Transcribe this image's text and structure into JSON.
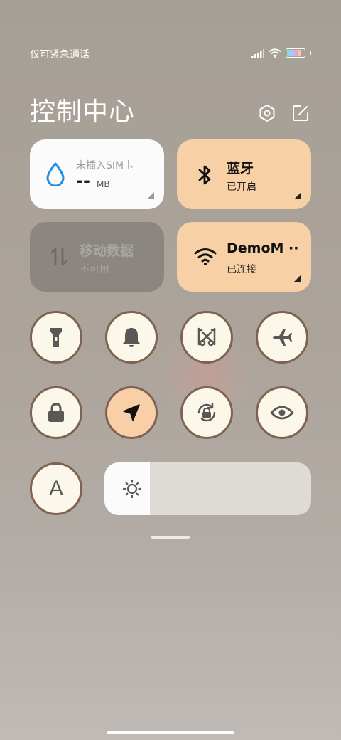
{
  "status_bar": {
    "carrier": "仅可紧急通话",
    "icons": [
      "signal-icon",
      "wifi-icon",
      "battery-icon"
    ],
    "battery_level": 0.9
  },
  "header": {
    "title": "控制中心",
    "icons": [
      "settings-icon",
      "edit-icon"
    ]
  },
  "tiles": {
    "sim": {
      "title": "未插入SIM卡",
      "value": "--",
      "unit": "MB",
      "icon": "water-drop-icon"
    },
    "bluetooth": {
      "title": "蓝牙",
      "status": "已开启",
      "icon": "bluetooth-icon",
      "active": true
    },
    "mobile_data": {
      "title": "移动数据",
      "status": "不可用",
      "icon": "data-arrows-icon",
      "active": false
    },
    "wifi": {
      "title": "DemoM ··",
      "status": "已连接",
      "icon": "wifi-icon",
      "active": true
    }
  },
  "toggles": [
    {
      "name": "flashlight",
      "icon": "flashlight-icon",
      "active": false
    },
    {
      "name": "silent",
      "icon": "bell-icon",
      "active": false
    },
    {
      "name": "screenshot",
      "icon": "scissors-icon",
      "active": false
    },
    {
      "name": "airplane",
      "icon": "airplane-icon",
      "active": false
    },
    {
      "name": "lock-screen",
      "icon": "lock-icon",
      "active": false
    },
    {
      "name": "location",
      "icon": "location-arrow-icon",
      "active": true
    },
    {
      "name": "rotation-lock",
      "icon": "rotation-lock-icon",
      "active": false
    },
    {
      "name": "reading-mode",
      "icon": "eye-icon",
      "active": false
    },
    {
      "name": "font-size",
      "icon": "font-a-icon",
      "active": false,
      "label": "A"
    }
  ],
  "brightness": {
    "icon": "sun-icon",
    "level": 0.22
  },
  "colors": {
    "active_tile": "#f8d0a6",
    "inactive_tile": "#8b8680",
    "toggle_bg": "#fbf8ea",
    "toggle_border": "#7e6252"
  }
}
